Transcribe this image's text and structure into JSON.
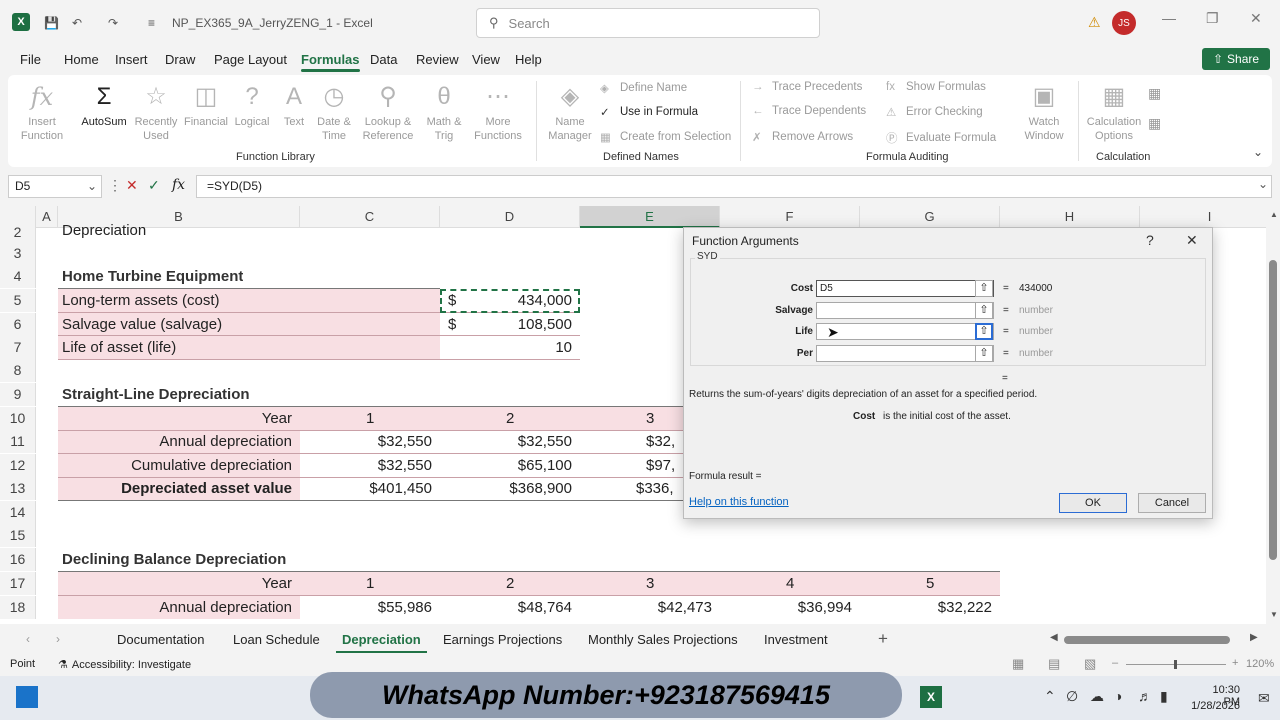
{
  "window": {
    "title": "NP_EX365_9A_JerryZENG_1  -  Excel",
    "search_placeholder": "Search",
    "user_initials": "JS"
  },
  "menu": {
    "tabs": [
      "File",
      "Home",
      "Insert",
      "Draw",
      "Page Layout",
      "Formulas",
      "Data",
      "Review",
      "View",
      "Help"
    ],
    "active": "Formulas",
    "share_label": "Share"
  },
  "ribbon": {
    "function_library": {
      "label": "Function Library",
      "insert_function": "Insert Function",
      "autosum": "AutoSum",
      "recently_used": "Recently Used",
      "financial": "Financial",
      "logical": "Logical",
      "text": "Text",
      "date_time": "Date & Time",
      "lookup_reference": "Lookup & Reference",
      "math_trig": "Math & Trig",
      "more_functions": "More Functions"
    },
    "defined_names": {
      "label": "Defined Names",
      "name_manager": "Name Manager",
      "define_name": "Define Name",
      "use_in_formula": "Use in Formula",
      "create_from_selection": "Create from Selection"
    },
    "formula_auditing": {
      "label": "Formula Auditing",
      "trace_precedents": "Trace Precedents",
      "trace_dependents": "Trace Dependents",
      "remove_arrows": "Remove Arrows",
      "show_formulas": "Show Formulas",
      "error_checking": "Error Checking",
      "evaluate_formula": "Evaluate Formula",
      "watch_window": "Watch Window"
    },
    "calculation": {
      "label": "Calculation",
      "calculation_options": "Calculation Options"
    }
  },
  "formula_bar": {
    "name_box": "D5",
    "formula": "=SYD(D5)"
  },
  "columns": [
    "A",
    "B",
    "C",
    "D",
    "E",
    "F",
    "G",
    "H",
    "I"
  ],
  "selected_column": "E",
  "rows": [
    "2",
    "3",
    "4",
    "5",
    "6",
    "7",
    "8",
    "9",
    "10",
    "11",
    "12",
    "13",
    "14",
    "15",
    "16",
    "17",
    "18"
  ],
  "sheet": {
    "r2_partial": "Depreciation",
    "section1_title": "Home Turbine Equipment",
    "r5": {
      "label": "Long-term assets (cost)",
      "currency": "$",
      "value": "434,000"
    },
    "r6": {
      "label": "Salvage value (salvage)",
      "currency": "$",
      "value": "108,500"
    },
    "r7": {
      "label": "Life of asset (life)",
      "value": "10"
    },
    "section2_title": "Straight-Line Depreciation",
    "sl": {
      "year_label": "Year",
      "years": [
        "1",
        "2",
        "3"
      ],
      "annual_label": "Annual depreciation",
      "annual": [
        "$32,550",
        "$32,550",
        "$32,"
      ],
      "cumulative_label": "Cumulative depreciation",
      "cumulative": [
        "$32,550",
        "$65,100",
        "$97,"
      ],
      "asset_label": "Depreciated asset value",
      "asset": [
        "$401,450",
        "$368,900",
        "$336,"
      ]
    },
    "section3_title": "Declining Balance Depreciation",
    "db": {
      "year_label": "Year",
      "years": [
        "1",
        "2",
        "3",
        "4",
        "5"
      ],
      "annual_label": "Annual depreciation",
      "annual": [
        "$55,986",
        "$48,764",
        "$42,473",
        "$36,994",
        "$32,222"
      ]
    }
  },
  "dialog": {
    "title": "Function Arguments",
    "help_glyph": "?",
    "close_glyph": "✕",
    "function_name": "SYD",
    "args": [
      {
        "label": "Cost",
        "value": "D5",
        "result": "434000"
      },
      {
        "label": "Salvage",
        "value": "",
        "result": "number"
      },
      {
        "label": "Life",
        "value": "",
        "result": "number"
      },
      {
        "label": "Per",
        "value": "",
        "result": "number"
      }
    ],
    "equals": "=",
    "description": "Returns the sum-of-years' digits depreciation of an asset for a specified period.",
    "arg_help_name": "Cost",
    "arg_help_text": "is the initial cost of the asset.",
    "formula_result": "Formula result =",
    "help_link": "Help on this function",
    "ok": "OK",
    "cancel": "Cancel"
  },
  "sheet_tabs": [
    "Documentation",
    "Loan Schedule",
    "Depreciation",
    "Earnings Projections",
    "Monthly Sales Projections",
    "Investment"
  ],
  "active_sheet": "Depreciation",
  "status": {
    "mode": "Point",
    "accessibility": "Accessibility: Investigate",
    "zoom": "120%"
  },
  "taskbar": {
    "banner": "WhatsApp Number:+923187569415",
    "time": "10:30 PM",
    "date": "1/28/2026"
  }
}
